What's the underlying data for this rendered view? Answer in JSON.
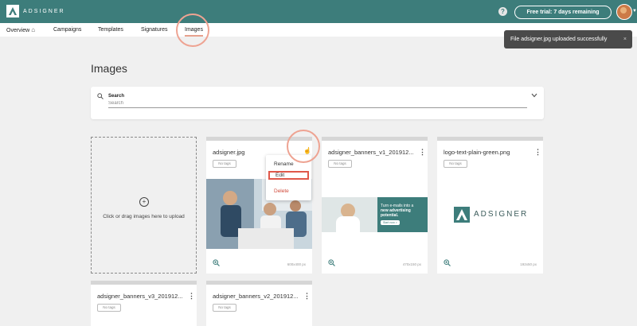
{
  "app": {
    "logo_text": "ADSIGNER",
    "brand_color": "#3d7d7b"
  },
  "header": {
    "trial_label": "Free trial: 7 days remaining",
    "help_icon": "question-circle-icon",
    "help_glyph": "?"
  },
  "nav": {
    "items": [
      {
        "label": "Overview"
      },
      {
        "label": "Campaigns"
      },
      {
        "label": "Templates"
      },
      {
        "label": "Signatures"
      },
      {
        "label": "Images"
      }
    ]
  },
  "toast": {
    "message": "File adsigner.jpg uploaded successfully",
    "close": "×"
  },
  "page": {
    "title": "Images"
  },
  "search": {
    "label": "Search",
    "placeholder": "Search"
  },
  "upload": {
    "text": "Click or drag images here to upload"
  },
  "cards": [
    {
      "title": "adsigner.jpg",
      "tag": "No tags",
      "dims": "600x400 px"
    },
    {
      "title": "adsigner_banners_v1_201912...",
      "tag": "No tags",
      "dims": "470x150 px",
      "banner_line1": "Turn e-mails into a",
      "banner_line2": "new advertising",
      "banner_line3": "potential.",
      "banner_cta": "Start now >"
    },
    {
      "title": "logo-text-plain-green.png",
      "tag": "No tags",
      "dims": "192x50 px",
      "logo_text": "ADSIGNER"
    },
    {
      "title": "adsigner_banners_v3_201912...",
      "tag": "No tags"
    },
    {
      "title": "adsigner_banners_v2_201912...",
      "tag": "No tags"
    }
  ],
  "context_menu": {
    "rename": "Rename",
    "edit": "Edit",
    "delete": "Delete"
  },
  "colors": {
    "accent": "#eea392",
    "delete": "#d04a3a",
    "toast_bg": "#4a4a4a"
  }
}
